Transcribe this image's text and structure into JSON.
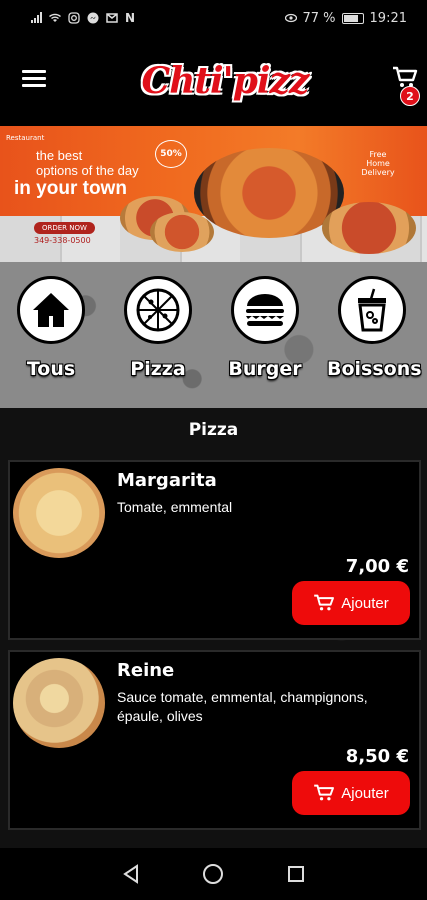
{
  "status_bar": {
    "battery": "77 %",
    "time": "19:21"
  },
  "header": {
    "brand": "Chti'pizz",
    "cart_count": "2"
  },
  "banner": {
    "chef_text": "Restaurant",
    "headline_1": "the best",
    "headline_2": "options of the day",
    "headline_3": "in your town",
    "discount": "50%",
    "delivery": "Free Home Delivery",
    "order_button": "ORDER NOW",
    "phone": "349-338-0500"
  },
  "categories": [
    {
      "label": "Tous",
      "icon": "home-icon"
    },
    {
      "label": "Pizza",
      "icon": "pizza-icon"
    },
    {
      "label": "Burger",
      "icon": "burger-icon"
    },
    {
      "label": "Boissons",
      "icon": "drink-icon"
    }
  ],
  "section": {
    "title": "Pizza"
  },
  "products": [
    {
      "name": "Margarita",
      "description": "Tomate, emmental",
      "price": "7,00  €",
      "button": "Ajouter"
    },
    {
      "name": "Reine",
      "description": "Sauce tomate, emmental, champignons, épaule, olives",
      "price": "8,50  €",
      "button": "Ajouter"
    }
  ],
  "colors": {
    "accent": "#ee0b0b",
    "background": "#000000"
  }
}
